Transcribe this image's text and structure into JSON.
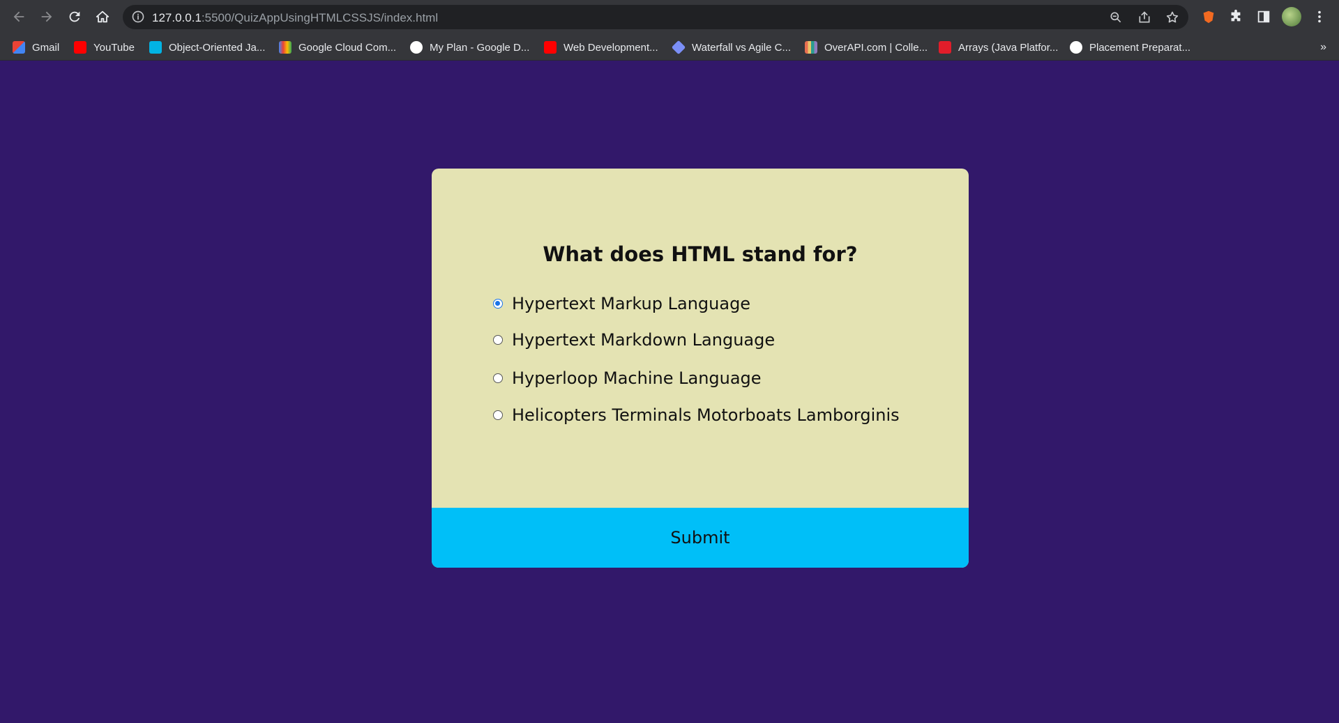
{
  "browser": {
    "url_host": "127.0.0.1",
    "url_rest": ":5500/QuizAppUsingHTMLCSSJS/index.html",
    "bookmarks": [
      {
        "label": "Gmail",
        "icon": "gmail-icon",
        "color": "#ea4335"
      },
      {
        "label": "YouTube",
        "icon": "youtube-icon",
        "color": "#ff0000"
      },
      {
        "label": "Object-Oriented Ja...",
        "icon": "udacity-icon",
        "color": "#02b3e4"
      },
      {
        "label": "Google Cloud Com...",
        "icon": "google-cloud-icon",
        "color": "#4285f4"
      },
      {
        "label": "My Plan - Google D...",
        "icon": "google-icon",
        "color": "#ffffff"
      },
      {
        "label": "Web Development...",
        "icon": "youtube-icon",
        "color": "#ff0000"
      },
      {
        "label": "Waterfall vs Agile C...",
        "icon": "diamond-icon",
        "color": "#7b8ff7"
      },
      {
        "label": "OverAPI.com | Colle...",
        "icon": "overapi-icon",
        "color": "#e9c46a"
      },
      {
        "label": "Arrays (Java Platfor...",
        "icon": "oracle-icon",
        "color": "#e11d2a"
      },
      {
        "label": "Placement Preparat...",
        "icon": "placement-icon",
        "color": "#ffffff"
      }
    ]
  },
  "quiz": {
    "question": "What does HTML stand for?",
    "answers": [
      {
        "label": "Hypertext Markup Language",
        "selected": true
      },
      {
        "label": "Hypertext Markdown Language",
        "selected": false
      },
      {
        "label": "Hyperloop Machine Language",
        "selected": false
      },
      {
        "label": "Helicopters Terminals Motorboats Lamborginis",
        "selected": false
      }
    ],
    "submit_label": "Submit"
  },
  "colors": {
    "page_background": "#32186a",
    "card_background": "#e4e3b3",
    "submit_background": "#00bff8"
  }
}
